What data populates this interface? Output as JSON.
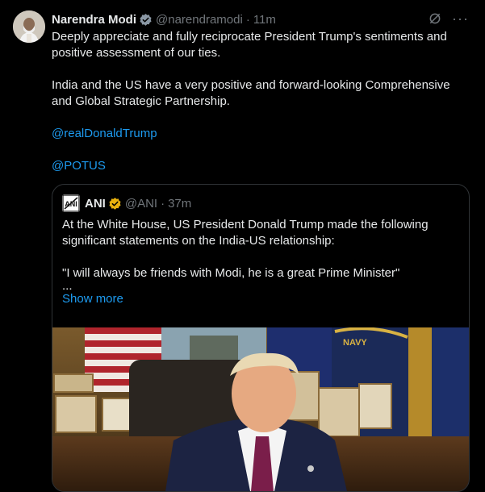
{
  "post": {
    "author_name": "Narendra Modi",
    "author_handle": "@narendramodi",
    "time": "11m",
    "dot": "·",
    "more_label": "···",
    "paragraphs": [
      "Deeply appreciate and fully reciprocate President Trump's sentiments and positive assessment of our ties.",
      "India and the US have a very positive and forward-looking Comprehensive and Global Strategic Partnership."
    ],
    "mentions": [
      "@realDonaldTrump",
      "@POTUS"
    ]
  },
  "quote": {
    "author_name": "ANI",
    "author_handle": "@ANI",
    "time": "37m",
    "dot": "·",
    "text": "At the White House, US President Donald Trump made the following significant statements on the India-US relationship:",
    "quote_line": "\"I will always be friends with Modi, he is a great Prime Minister\"",
    "ellipsis": "...",
    "show_more": "Show more",
    "logo_text": "ANI"
  },
  "colors": {
    "background": "#000000",
    "text": "#e7e9ea",
    "muted": "#71767b",
    "link": "#1d9bf0",
    "verified_gold": "#e8b10e"
  },
  "icons": {
    "verified_primary": "verified-badge-icon",
    "grok": "grok-icon",
    "more": "more-icon",
    "verified_quote": "verified-badge-icon"
  }
}
